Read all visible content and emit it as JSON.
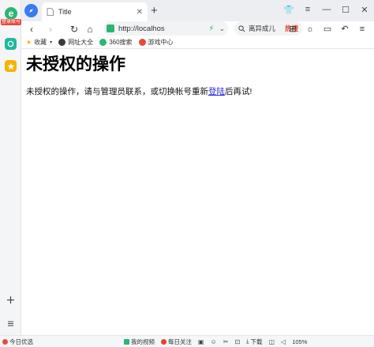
{
  "rail": {
    "login_label": "登录账号"
  },
  "tab": {
    "title": "Title"
  },
  "address_bar": {
    "url": "http://localhos"
  },
  "search_box": {
    "text": "离异成儿",
    "hot_label": "热搜"
  },
  "bookmarks": [
    {
      "label": "收藏",
      "icon": "star-icon",
      "color": "#f5b400"
    },
    {
      "label": "网址大全",
      "icon": "globe-icon",
      "color": "#3a3a3a"
    },
    {
      "label": "360搜索",
      "icon": "search360-icon",
      "color": "#2bb673"
    },
    {
      "label": "游戏中心",
      "icon": "game-icon",
      "color": "#e84a3d"
    }
  ],
  "page": {
    "title": "未授权的操作",
    "message_before": "未授权的操作，请与管理员联系，或切换帐号重新",
    "message_link": "登陆",
    "message_after": "后再试!"
  },
  "statusbar": {
    "left_item": "今日优选",
    "video": "我的视频",
    "daily": "每日关注",
    "download": "下载",
    "zoom": "105%"
  },
  "colors": {
    "accent": "#3a7bf0",
    "green": "#2bb673",
    "hot": "#e5412e",
    "link": "#2a2ae0"
  }
}
